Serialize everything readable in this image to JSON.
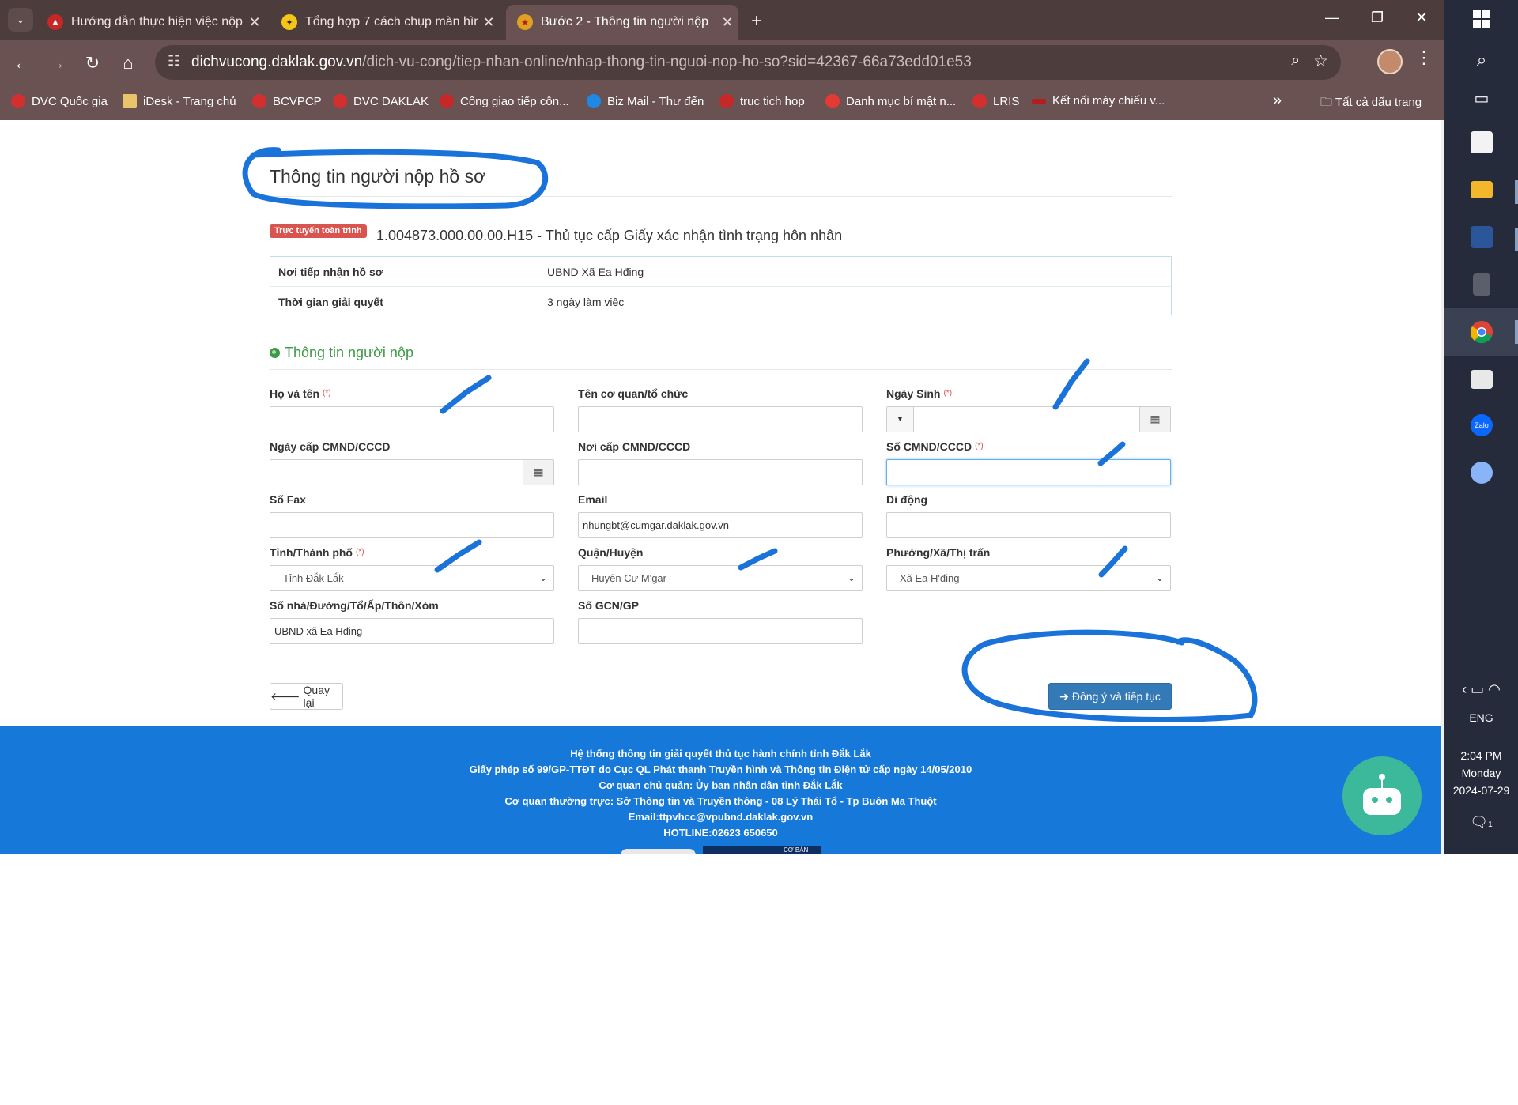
{
  "browser": {
    "tabs": [
      {
        "title": "Hướng dẫn thực hiện việc nộp l",
        "active": false
      },
      {
        "title": "Tổng hợp 7 cách chụp màn hìn",
        "active": false
      },
      {
        "title": "Bước 2 - Thông tin người nộp",
        "active": true
      }
    ],
    "url_host": "dichvucong.daklak.gov.vn",
    "url_path": "/dich-vu-cong/tiep-nhan-online/nhap-thong-tin-nguoi-nop-ho-so?sid=42367-66a73edd01e53",
    "bookmarks": [
      "DVC Quốc gia",
      "iDesk - Trang chủ",
      "BCVPCP",
      "DVC DAKLAK",
      "Cổng giao tiếp côn...",
      "Biz Mail - Thư đến",
      "truc tich hop",
      "Danh mục bí mật n...",
      "LRIS",
      "Kết nối máy chiếu v..."
    ],
    "all_bookmarks": "Tất cả dấu trang"
  },
  "page": {
    "title": "Thông tin người nộp hồ sơ",
    "badge": "Trực tuyến toàn trình",
    "procedure": "1.004873.000.00.00.H15 - Thủ tục cấp Giấy xác nhận tình trạng hôn nhân",
    "info": {
      "receive_label": "Nơi tiếp nhận hồ sơ",
      "receive_value": "UBND Xã Ea Hđing",
      "time_label": "Thời gian giải quyết",
      "time_value": "3 ngày làm việc"
    },
    "section_title": "Thông tin người nộp",
    "required_mark": "(*)",
    "form": {
      "ho_ten": {
        "label": "Họ và tên",
        "value": ""
      },
      "co_quan": {
        "label": "Tên cơ quan/tổ chức",
        "value": ""
      },
      "ngay_sinh": {
        "label": "Ngày Sinh",
        "value": ""
      },
      "ngay_cap": {
        "label": "Ngày cấp CMND/CCCD",
        "value": ""
      },
      "noi_cap": {
        "label": "Nơi cấp CMND/CCCD",
        "value": ""
      },
      "so_cmnd": {
        "label": "Số CMND/CCCD",
        "value": ""
      },
      "so_fax": {
        "label": "Số Fax",
        "value": ""
      },
      "email": {
        "label": "Email",
        "value": "nhungbt@cumgar.daklak.gov.vn"
      },
      "di_dong": {
        "label": "Di động",
        "value": ""
      },
      "tinh": {
        "label": "Tỉnh/Thành phố",
        "value": "Tỉnh Đắk Lắk"
      },
      "huyen": {
        "label": "Quận/Huyện",
        "value": "Huyện Cư M'gar"
      },
      "xa": {
        "label": "Phường/Xã/Thị trấn",
        "value": "Xã Ea H'đing"
      },
      "so_nha": {
        "label": "Số nhà/Đường/Tổ/Ấp/Thôn/Xóm",
        "value": "UBND xã Ea Hđing"
      },
      "so_gcn": {
        "label": "Số GCN/GP",
        "value": ""
      }
    },
    "buttons": {
      "back": "Quay lại",
      "next": "Đồng ý và tiếp tục"
    },
    "footer": [
      "Hệ thống thông tin giải quyết thủ tục hành chính tỉnh Đắk Lắk",
      "Giấy phép số 99/GP-TTĐT do Cục QL Phát thanh Truyền hình và Thông tin Điện tử cấp ngày 14/05/2010",
      "Cơ quan chủ quản: Ủy ban nhân dân tỉnh Đắk Lắk",
      "Cơ quan thường trực: Sở Thông tin và Truyền thông - 08 Lý Thái Tổ - Tp Buôn Ma Thuột",
      "Email:ttpvhcc@vpubnd.daklak.gov.vn",
      "HOTLINE:02623 650650"
    ],
    "seal_text": "CƠ BẢN"
  },
  "taskbar": {
    "lang": "ENG",
    "time": "2:04 PM",
    "day": "Monday",
    "date": "2024-07-29",
    "notif_count": "1",
    "zalo_label": "Zalo"
  },
  "colors": {
    "ink": "#1a73d9",
    "footer": "#1679d9",
    "section_green": "#3c9a46",
    "primary_button": "#337ab7",
    "badge_red": "#d9534f"
  }
}
